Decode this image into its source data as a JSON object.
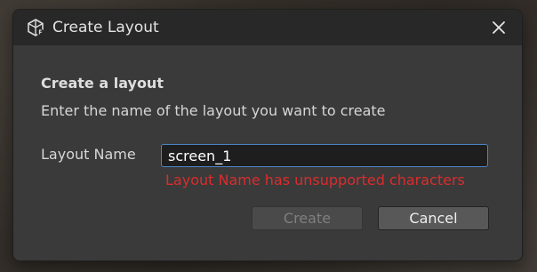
{
  "dialog": {
    "title": "Create Layout",
    "app_icon": "unity-logo-icon",
    "close_icon": "close-icon"
  },
  "content": {
    "heading": "Create a layout",
    "description": "Enter the name of the layout you want to create"
  },
  "form": {
    "label": "Layout Name",
    "value": "screen_1",
    "error": "Layout Name has unsupported characters"
  },
  "buttons": {
    "create": "Create",
    "cancel": "Cancel"
  },
  "colors": {
    "error": "#d92d2d",
    "focus_border": "#4b86c6"
  }
}
